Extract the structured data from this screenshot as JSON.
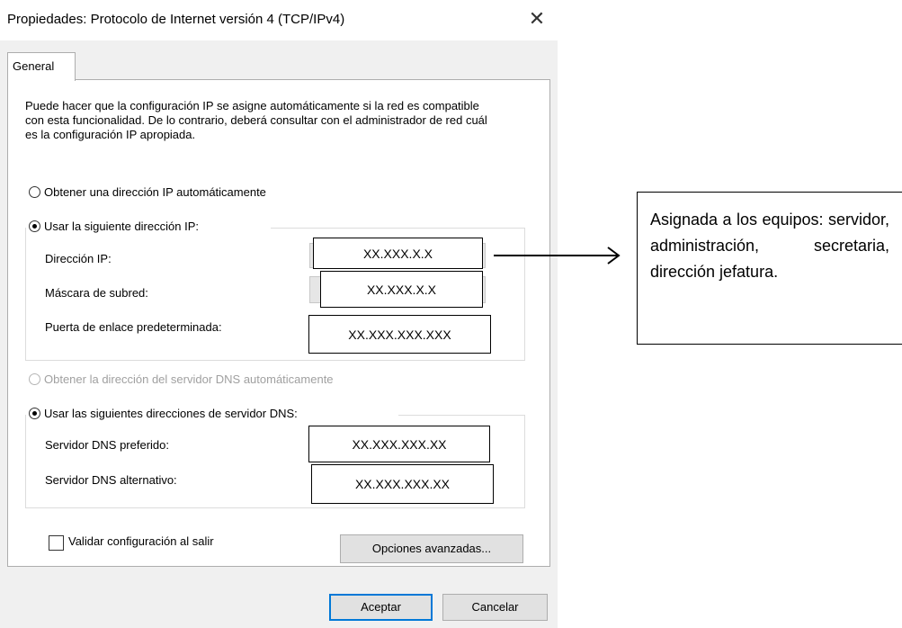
{
  "window": {
    "title": "Propiedades: Protocolo de Internet versión 4 (TCP/IPv4)",
    "close_glyph": "✕"
  },
  "tabs": [
    {
      "label": "General",
      "selected": true
    }
  ],
  "description": "Puede hacer que la configuración IP se asigne automáticamente si la red es compatible con esta funcionalidad. De lo contrario, deberá consultar con el administrador de red cuál es la configuración IP apropiada.",
  "ip": {
    "auto_option": {
      "label": "Obtener una dirección IP automáticamente",
      "selected": false
    },
    "manual_option": {
      "label": "Usar la siguiente dirección IP:",
      "selected": true
    },
    "fields": [
      {
        "label": "Dirección IP:",
        "value": "XX.XXX.X.X"
      },
      {
        "label": "Máscara de subred:",
        "value": "XX.XXX.X.X"
      },
      {
        "label": "Puerta de enlace predeterminada:",
        "value": "XX.XXX.XXX.XXX"
      }
    ]
  },
  "dns": {
    "auto_option": {
      "label": "Obtener la dirección del servidor DNS automáticamente",
      "selected": false,
      "disabled": true
    },
    "manual_option": {
      "label": "Usar las siguientes direcciones de servidor DNS:",
      "selected": true
    },
    "fields": [
      {
        "label": "Servidor DNS preferido:",
        "value": "XX.XXX.XXX.XX"
      },
      {
        "label": "Servidor DNS alternativo:",
        "value": "XX.XXX.XXX.XX"
      }
    ]
  },
  "validate": {
    "label": "Validar configuración al salir",
    "checked": false
  },
  "buttons": {
    "advanced": "Opciones avanzadas...",
    "ok": "Aceptar",
    "cancel": "Cancelar"
  },
  "annotation": {
    "text": "Asignada a los equipos: servidor, administración, secretaria, dirección jefatura."
  },
  "colors": {
    "dialog_bg": "#f0f0f0",
    "default_button_border": "#0078d7",
    "disabled_text": "#a0a0a0"
  }
}
